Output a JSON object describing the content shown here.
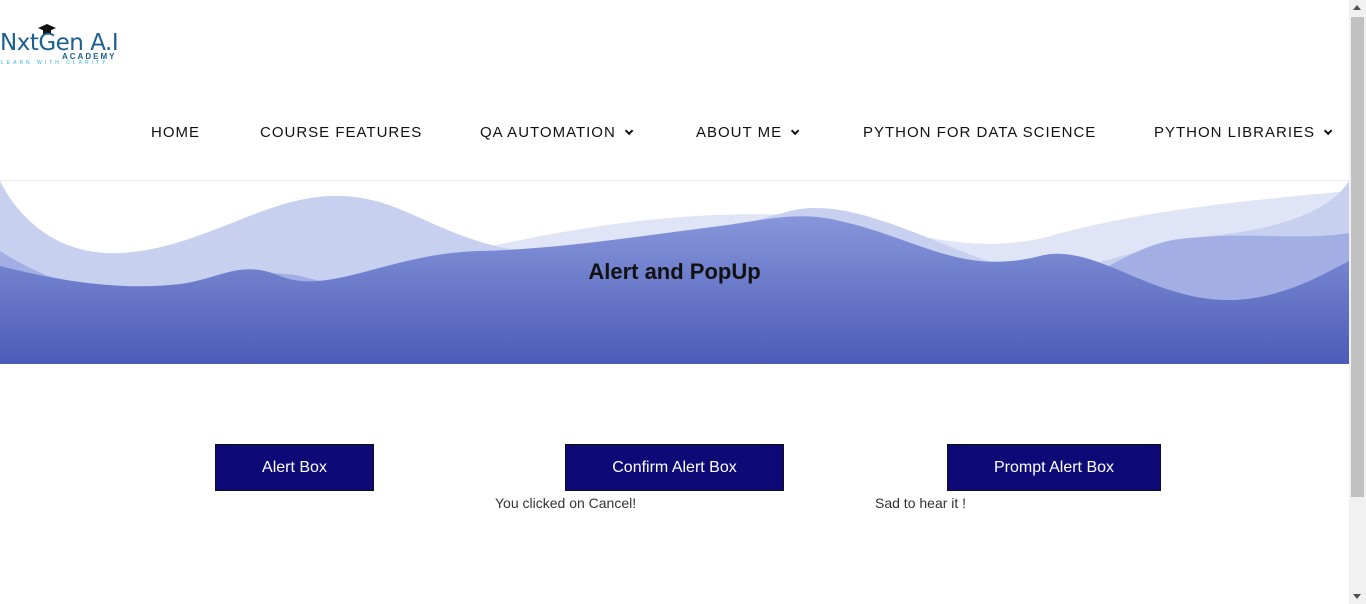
{
  "logo": {
    "main": "NxtGen A.I",
    "sub": "ACADEMY",
    "tagline": "LEARN WITH CLARITY"
  },
  "nav": {
    "items": [
      {
        "label": "HOME",
        "has_dropdown": false
      },
      {
        "label": "COURSE FEATURES",
        "has_dropdown": false
      },
      {
        "label": "QA AUTOMATION",
        "has_dropdown": true
      },
      {
        "label": "ABOUT ME",
        "has_dropdown": true
      },
      {
        "label": "PYTHON FOR DATA SCIENCE",
        "has_dropdown": false
      },
      {
        "label": "PYTHON LIBRARIES",
        "has_dropdown": true
      }
    ]
  },
  "hero": {
    "title": "Alert and PopUp"
  },
  "actions": {
    "alert_label": "Alert Box",
    "confirm_label": "Confirm Alert Box",
    "prompt_label": "Prompt Alert Box",
    "confirm_result": "You clicked on Cancel!",
    "prompt_result": "Sad to hear it !"
  },
  "colors": {
    "button_bg": "#0d0a78",
    "hero_dark": "#4f5fb8",
    "hero_light": "#dde3f6",
    "logo": "#1b5f8f"
  }
}
